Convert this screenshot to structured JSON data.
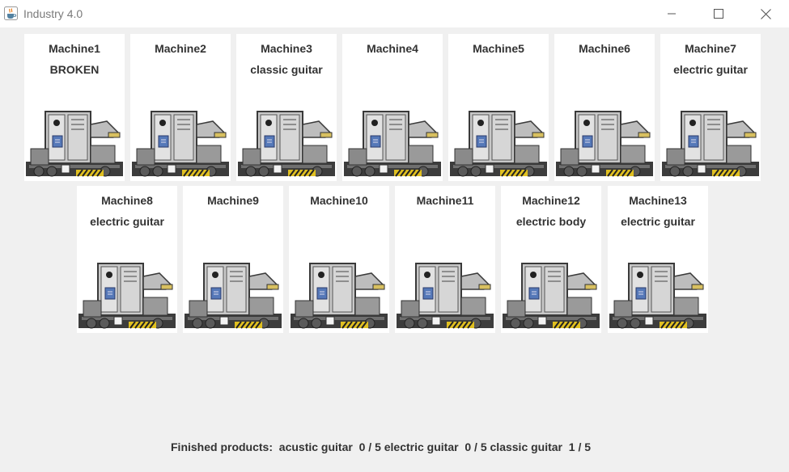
{
  "window": {
    "title": "Industry 4.0",
    "icon": "java-coffee-icon",
    "controls": [
      "minimize-icon",
      "maximize-icon",
      "close-icon"
    ]
  },
  "machines": [
    {
      "name": "Machine1",
      "status": "BROKEN"
    },
    {
      "name": "Machine2",
      "status": ""
    },
    {
      "name": "Machine3",
      "status": "classic guitar"
    },
    {
      "name": "Machine4",
      "status": ""
    },
    {
      "name": "Machine5",
      "status": ""
    },
    {
      "name": "Machine6",
      "status": ""
    },
    {
      "name": "Machine7",
      "status": "electric guitar"
    },
    {
      "name": "Machine8",
      "status": "electric guitar"
    },
    {
      "name": "Machine9",
      "status": ""
    },
    {
      "name": "Machine10",
      "status": ""
    },
    {
      "name": "Machine11",
      "status": ""
    },
    {
      "name": "Machine12",
      "status": "electric body"
    },
    {
      "name": "Machine13",
      "status": "electric guitar"
    }
  ],
  "footer": {
    "label": "Finished products:",
    "products": [
      {
        "name": "acustic guitar",
        "count": "0",
        "sep": "/",
        "total": "5"
      },
      {
        "name": "electric guitar",
        "count": "0",
        "sep": "/",
        "total": "5"
      },
      {
        "name": "classic guitar",
        "count": "1",
        "sep": "/",
        "total": "5"
      }
    ]
  }
}
